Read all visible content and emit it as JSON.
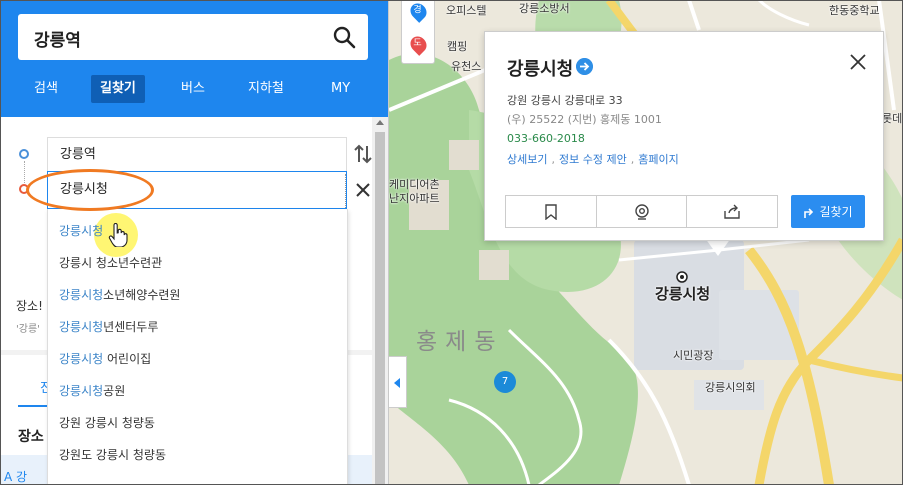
{
  "search": {
    "query": "강릉역"
  },
  "tabs": [
    {
      "label": "검색"
    },
    {
      "label": "길찾기"
    },
    {
      "label": "버스"
    },
    {
      "label": "지하철"
    },
    {
      "label": "MY"
    }
  ],
  "route": {
    "start": "강릉역",
    "end": "강릉시청"
  },
  "suggestions": [
    {
      "hl": "강릉시청",
      "rest": ""
    },
    {
      "hl": "",
      "rest": "강릉시 청소년수련관"
    },
    {
      "hl": "강릉시청",
      "rest": "소년해양수련원"
    },
    {
      "hl": "강릉시청",
      "rest": "년센터두루"
    },
    {
      "hl": "강릉시청",
      "rest": " 어린이집"
    },
    {
      "hl": "강릉시청",
      "rest": "공원"
    },
    {
      "hl": "",
      "rest": "강원 강릉시 청량동"
    },
    {
      "hl": "",
      "rest": "강원도 강릉시 청량동"
    }
  ],
  "background_panel": {
    "title_fragment": "장소!",
    "sub_fragment": "'강릉'",
    "tab_fragment": "진",
    "row_fragment": "장소",
    "bottom_fragment": "A 강"
  },
  "map": {
    "district": "홍제동",
    "labels": {
      "officetel": "오피스텔",
      "fire_station": "강릉소방서",
      "school": "한동중학교",
      "camping": "캠핑",
      "yuchon": "유천스",
      "media": "케미디어촌",
      "apt": "난지아파트",
      "rote": "롯데",
      "square": "시민광장",
      "council": "강릉시의회",
      "cityhall": "강릉시청"
    },
    "float_buttons": [
      "경",
      "도"
    ],
    "corner_badge": "7"
  },
  "popup": {
    "title": "강릉시청",
    "address": "강원 강릉시 강릉대로 33",
    "zip": "(우) 25522  (지번) 홍제동 1001",
    "phone": "033-660-2018",
    "links": [
      "상세보기",
      "정보 수정 제안",
      "홈페이지"
    ],
    "route_label": "길찾기"
  },
  "colors": {
    "brand_blue": "#1e86ee",
    "highlight": "#3b84c8",
    "annotation_orange": "#f07a22",
    "map_green": "#a9d39a",
    "road_yellow": "#f4d66a"
  }
}
